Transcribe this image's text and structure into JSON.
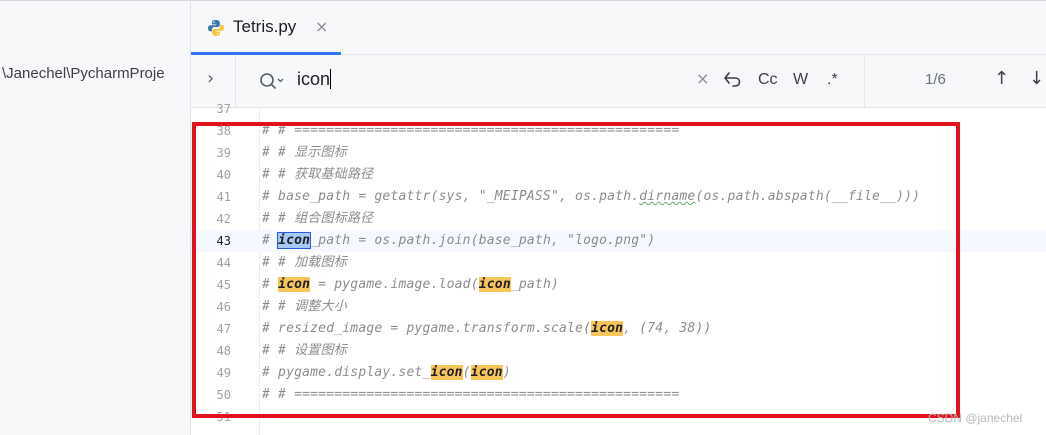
{
  "sidebar": {
    "path_text": "\\Janechel\\PycharmProje"
  },
  "tab": {
    "title": "Tetris.py",
    "close_glyph": "×"
  },
  "find": {
    "expand_glyph": "›",
    "query": "icon",
    "clear_glyph": "×",
    "match_case_label": "Cc",
    "words_label": "W",
    "regex_label": ".*",
    "match_count": "1/6",
    "prev_glyph": "↑",
    "next_glyph": "↓"
  },
  "editor": {
    "lines": [
      {
        "num": "37",
        "segments": []
      },
      {
        "num": "38",
        "segments": [
          {
            "t": "# # ================================================"
          }
        ]
      },
      {
        "num": "39",
        "segments": [
          {
            "t": "# # 显示图标"
          }
        ]
      },
      {
        "num": "40",
        "segments": [
          {
            "t": "# # 获取基础路径"
          }
        ]
      },
      {
        "num": "41",
        "segments": [
          {
            "t": "# base_path = getattr(sys, \"_MEIPASS\", os.path."
          },
          {
            "t": "dirname",
            "k": "squig"
          },
          {
            "t": "(os.path.abspath(__file__)))"
          }
        ]
      },
      {
        "num": "42",
        "segments": [
          {
            "t": "# # 组合图标路径"
          }
        ]
      },
      {
        "num": "43",
        "current": true,
        "segments": [
          {
            "t": "# "
          },
          {
            "t": "icon",
            "k": "sel"
          },
          {
            "t": "_path = os.path.join(base_path, \"logo.png\")"
          }
        ]
      },
      {
        "num": "44",
        "segments": [
          {
            "t": "# # 加载图标"
          }
        ]
      },
      {
        "num": "45",
        "segments": [
          {
            "t": "# "
          },
          {
            "t": "icon",
            "k": "hl"
          },
          {
            "t": " = pygame.image.load("
          },
          {
            "t": "icon",
            "k": "hl"
          },
          {
            "t": "_path)"
          }
        ]
      },
      {
        "num": "46",
        "segments": [
          {
            "t": "# # 调整大小"
          }
        ]
      },
      {
        "num": "47",
        "segments": [
          {
            "t": "# resized_image = pygame.transform.scale("
          },
          {
            "t": "icon",
            "k": "hl"
          },
          {
            "t": ", (74, 38))"
          }
        ]
      },
      {
        "num": "48",
        "segments": [
          {
            "t": "# # 设置图标"
          }
        ]
      },
      {
        "num": "49",
        "segments": [
          {
            "t": "# pygame.display.set_"
          },
          {
            "t": "icon",
            "k": "hl"
          },
          {
            "t": "("
          },
          {
            "t": "icon",
            "k": "hl"
          },
          {
            "t": ")"
          }
        ]
      },
      {
        "num": "50",
        "segments": [
          {
            "t": "# # ================================================"
          }
        ]
      },
      {
        "num": "51",
        "segments": []
      }
    ]
  },
  "watermark": "CSDN @janechel",
  "colors": {
    "accent": "#3574f0",
    "match": "#f7c65b",
    "selection": "#a6c9f5",
    "annotation": "#e0131d"
  },
  "icons": {
    "tab_icon": "python-icon",
    "search": "search-icon",
    "newline": "newline-icon"
  }
}
